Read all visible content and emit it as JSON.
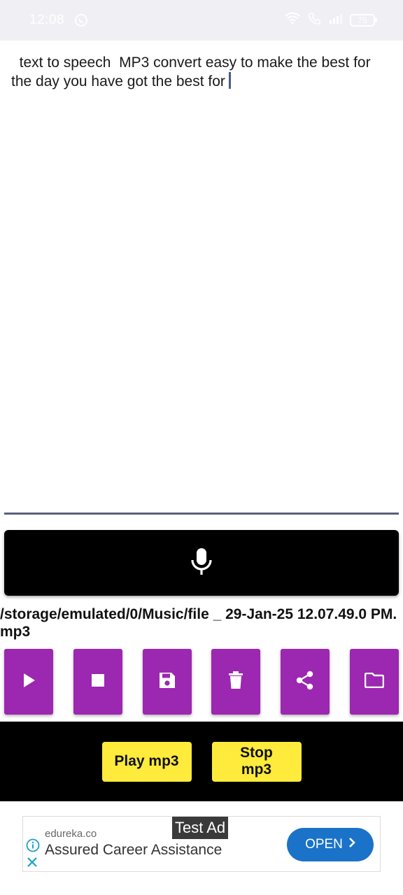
{
  "status_bar": {
    "time": "12:08",
    "battery": "75"
  },
  "editor": {
    "text": "  text to speech  MP3 convert easy to make the best for the day you have got the best for"
  },
  "file": {
    "path": "/storage/emulated/0/Music/file _ 29-Jan-25 12.07.49.0 PM.mp3"
  },
  "player": {
    "play_label": "Play mp3",
    "stop_label": "Stop mp3"
  },
  "ad": {
    "tag": "Test Ad",
    "domain": "edureka.co",
    "headline": "Assured Career Assistance",
    "cta": "OPEN"
  },
  "colors": {
    "action_purple": "#9c27b0",
    "player_yellow": "#ffeb3b",
    "ad_blue": "#1a73c8"
  },
  "icons": {
    "action_buttons": [
      "play-icon",
      "stop-icon",
      "save-icon",
      "delete-icon",
      "share-icon",
      "folder-icon"
    ],
    "mic": "microphone-icon"
  }
}
